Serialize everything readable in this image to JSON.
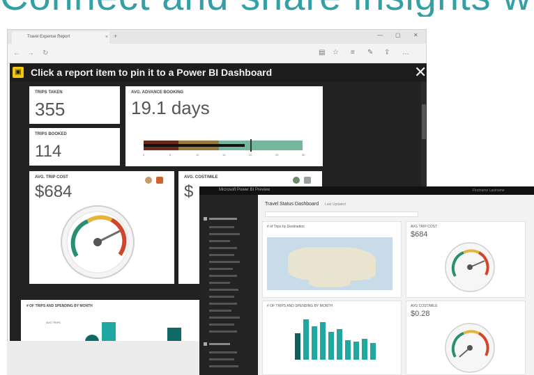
{
  "heading": "Connect and share insights with Power BI",
  "browser": {
    "tab_title": "Travel Expense Report",
    "tab_close": "×",
    "new_tab": "+",
    "controls": [
      "—",
      "▢",
      "✕"
    ]
  },
  "banner": {
    "text": "Click a report item to pin it to a Power BI Dashboard",
    "close": "✕"
  },
  "cards": {
    "trips_taken": {
      "title": "TRIPS TAKEN",
      "value": "355"
    },
    "trips_booked": {
      "title": "TRIPS BOOKED",
      "value": "114"
    },
    "advance_booking": {
      "title": "AVG. ADVANCE BOOKING",
      "value": "19.1 days",
      "scale": [
        "0",
        "5",
        "10",
        "15",
        "20",
        "25",
        "30"
      ],
      "level_days": 19.1
    },
    "trip_cost": {
      "title": "AVG. TRIP COST",
      "value": "$684"
    },
    "cost_mile": {
      "title": "AVG. COST/MILE",
      "value": "$"
    },
    "trips_by_month": {
      "title": "# OF TRIPS AND SPENDING BY MONTH",
      "legend": "AVG TRIPS"
    }
  },
  "dashboard": {
    "app_title": "Microsoft Power BI Preview",
    "user": "Firstname Lastname",
    "title": "Travel Status Dashboard",
    "subtitle": "Last Updated",
    "trip_cost_title": "AVG TRIP COST",
    "trip_cost_value": "$684",
    "cost_mile_title": "AVG COST/MILE",
    "cost_mile_value": "$0.28",
    "map_title": "# of Trips by Destination",
    "chart_title": "# OF TRIPS AND SPENDING BY MONTH"
  }
}
